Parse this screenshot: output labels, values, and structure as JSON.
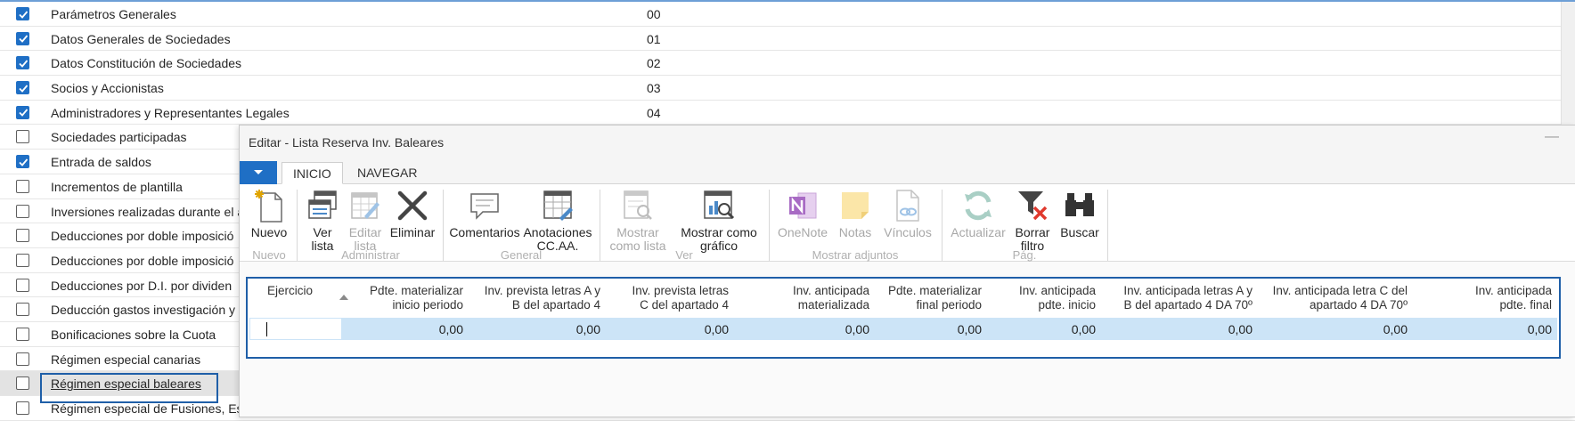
{
  "background_list": {
    "rows": [
      {
        "label": "Parámetros Generales",
        "code": "00",
        "checked": true
      },
      {
        "label": "Datos Generales de Sociedades",
        "code": "01",
        "checked": true
      },
      {
        "label": "Datos Constitución de Sociedades",
        "code": "02",
        "checked": true
      },
      {
        "label": "Socios y Accionistas",
        "code": "03",
        "checked": true
      },
      {
        "label": "Administradores y Representantes Legales",
        "code": "04",
        "checked": true
      },
      {
        "label": "Sociedades participadas",
        "code": "",
        "checked": false
      },
      {
        "label": "Entrada de saldos",
        "code": "",
        "checked": true
      },
      {
        "label": "Incrementos de plantilla",
        "code": "",
        "checked": false
      },
      {
        "label": "Inversiones realizadas durante el a",
        "code": "",
        "checked": false
      },
      {
        "label": "Deducciones por doble imposició",
        "code": "",
        "checked": false
      },
      {
        "label": "Deducciones por doble imposició",
        "code": "",
        "checked": false
      },
      {
        "label": "Deducciones por D.I. por dividen",
        "code": "",
        "checked": false
      },
      {
        "label": "Deducción gastos investigación y",
        "code": "",
        "checked": false
      },
      {
        "label": "Bonificaciones sobre la Cuota",
        "code": "",
        "checked": false
      },
      {
        "label": "Régimen especial canarias",
        "code": "",
        "checked": false
      },
      {
        "label": "Régimen especial baleares",
        "code": "",
        "checked": false,
        "selected": true
      },
      {
        "label": "Régimen especial de Fusiones, Es",
        "code": "",
        "checked": false
      }
    ]
  },
  "dialog": {
    "title": "Editar - Lista Reserva Inv. Baleares",
    "tabs": [
      "INICIO",
      "NAVEGAR"
    ],
    "ribbon": {
      "nuevo": {
        "label": "Nuevo",
        "group": "Nuevo"
      },
      "ver_lista": {
        "line1": "Ver",
        "line2": "lista"
      },
      "editar_lista": {
        "line1": "Editar",
        "line2": "lista"
      },
      "eliminar": {
        "label": "Eliminar"
      },
      "administrar_group": "Administrar",
      "comentarios": {
        "label": "Comentarios"
      },
      "anotaciones": {
        "line1": "Anotaciones",
        "line2": "CC.AA."
      },
      "general_group": "General",
      "mostrar_lista": {
        "line1": "Mostrar",
        "line2": "como lista"
      },
      "mostrar_grafico": {
        "line1": "Mostrar como",
        "line2": "gráfico"
      },
      "ver_group": "Ver",
      "onenote": {
        "label": "OneNote"
      },
      "notas": {
        "label": "Notas"
      },
      "vinculos": {
        "label": "Vínculos"
      },
      "adjuntos_group": "Mostrar adjuntos",
      "actualizar": {
        "label": "Actualizar"
      },
      "borrar_filtro": {
        "line1": "Borrar",
        "line2": "filtro"
      },
      "buscar": {
        "label": "Buscar"
      },
      "pag_group": "Pág."
    },
    "grid": {
      "headers": [
        {
          "line1": "Ejercicio",
          "line2": ""
        },
        {
          "line1": "Pdte. materializar",
          "line2": "inicio periodo"
        },
        {
          "line1": "Inv. prevista letras A y",
          "line2": "B del apartado 4"
        },
        {
          "line1": "Inv. prevista letras",
          "line2": "C del apartado 4"
        },
        {
          "line1": "Inv. anticipada",
          "line2": "materializada"
        },
        {
          "line1": "Pdte. materializar",
          "line2": "final periodo"
        },
        {
          "line1": "Inv. anticipada",
          "line2": "pdte. inicio"
        },
        {
          "line1": "Inv. anticipada letras A y",
          "line2": "B del apartado 4 DA 70º"
        },
        {
          "line1": "Inv. anticipada letra C del",
          "line2": "apartado 4 DA 70º"
        },
        {
          "line1": "Inv. anticipada",
          "line2": "pdte. final"
        }
      ],
      "row": [
        "",
        "0,00",
        "0,00",
        "0,00",
        "0,00",
        "0,00",
        "0,00",
        "0,00",
        "0,00",
        "0,00"
      ]
    }
  },
  "colors": {
    "accent": "#1f6fc5",
    "selection_border": "#1f5fa8",
    "row_highlight": "#cce4f7"
  }
}
